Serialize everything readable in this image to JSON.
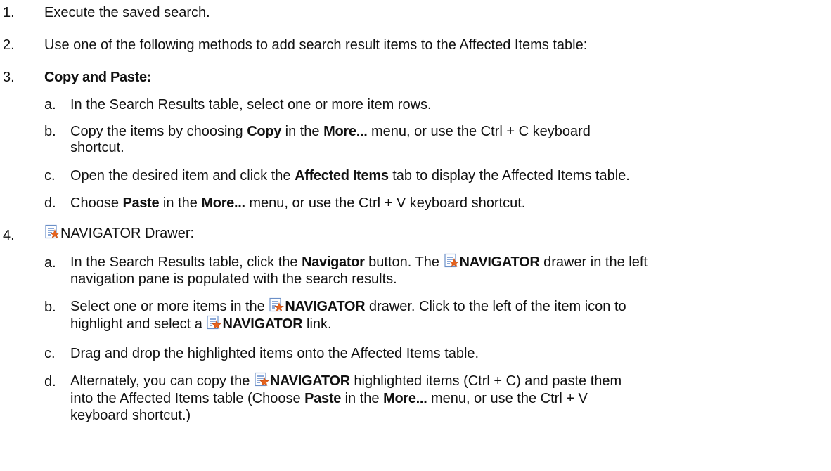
{
  "steps": [
    {
      "num": "1.",
      "text": "Execute the saved search."
    },
    {
      "num": "2.",
      "text": "Use one of the following methods to add search result items to the Affected Items table:"
    },
    {
      "num": "3.",
      "title": "Copy and Paste:",
      "items": [
        {
          "letter": "a.",
          "text": "In the Search Results table, select one or more item rows."
        },
        {
          "letter": "b.",
          "t1": "Copy the items by choosing ",
          "b1": "Copy",
          "t2": " in the ",
          "b2": "More...",
          "t3": " menu, or use the Ctrl + C keyboard",
          "t4": "shortcut."
        },
        {
          "letter": "c.",
          "t1": "Open the desired item and click the ",
          "b1": "Affected Items",
          "t2": " tab to display the Affected Items table."
        },
        {
          "letter": "d.",
          "t1": "Choose ",
          "b1": "Paste",
          "t2": " in the ",
          "b2": "More...",
          "t3": " menu, or use the Ctrl + V keyboard shortcut."
        }
      ]
    },
    {
      "num": "4.",
      "title": "NAVIGATOR Drawer:",
      "items": [
        {
          "letter": "a.",
          "t1": "In the Search Results table, click the ",
          "b1": "Navigator",
          "t2": " button. The ",
          "b2": "NAVIGATOR",
          "t3": " drawer in the left",
          "t4": "navigation pane is populated with the search results."
        },
        {
          "letter": "b.",
          "t1": "Select one or more items in the ",
          "b1": "NAVIGATOR",
          "t2": " drawer. Click to the left of the item icon to",
          "t3": "highlight and select a ",
          "b2": "NAVIGATOR",
          "t4": " link."
        },
        {
          "letter": "c.",
          "text": "Drag and drop the highlighted items onto the Affected Items table."
        },
        {
          "letter": "d.",
          "t1": "Alternately, you can copy the ",
          "b1": "NAVIGATOR",
          "t2": " highlighted items (Ctrl + C) and paste them",
          "t3": "into the Affected Items table (Choose ",
          "b2": "Paste",
          "t4": " in the ",
          "b3": "More...",
          "t5": " menu, or use the Ctrl + V",
          "t6": "keyboard shortcut.)"
        }
      ]
    }
  ],
  "icon": {
    "name": "navigator-icon",
    "colors": {
      "page": "#ffffff",
      "border": "#6b8fc7",
      "star": "#e8641e",
      "lines": "#4a78c2"
    }
  }
}
